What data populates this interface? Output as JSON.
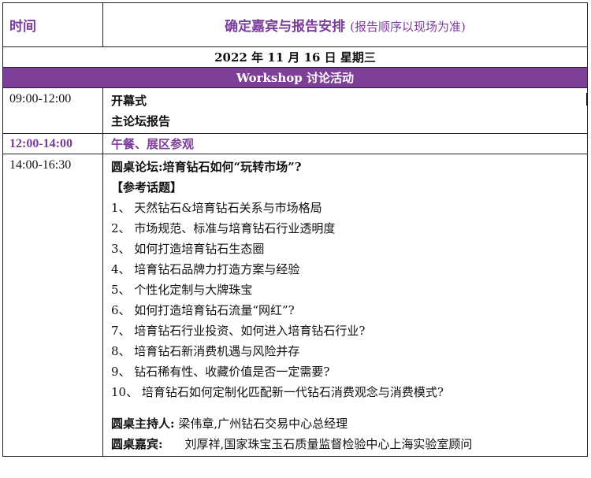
{
  "header": {
    "time_label": "时间",
    "title": "确定嘉宾与报告安排",
    "title_note": "(报告顺序以现场为准)"
  },
  "date_line": "2022 年 11 月 16 日    星期三",
  "workshop_bar": "Workshop 讨论活动",
  "sessions": [
    {
      "time": "09:00-12:00",
      "lines": [
        "开幕式",
        "主论坛报告"
      ]
    },
    {
      "time": "12:00-14:00",
      "text": "午餐、展区参观"
    },
    {
      "time": "14:00-16:30",
      "title": "圆桌论坛:培育钻石如何“玩转市场”?",
      "topics_header": "【参考话题】",
      "topics": [
        "1、 天然钻石&培育钻石关系与市场格局",
        "2、 市场规范、标准与培育钻石行业透明度",
        "3、 如何打造培育钻石生态圈",
        "4、 培育钻石品牌力打造方案与经验",
        "5、 个性化定制与大牌珠宝",
        "6、 如何打造培育钻石流量“网红”?",
        "7、 培育钻石行业投资、如何进入培育钻石行业?",
        "8、 培育钻石新消费机遇与风险并存",
        "9、 钻石稀有性、收藏价值是否一定需要?",
        "10、 培育钻石如何定制化匹配新一代钻石消费观念与消费模式?"
      ],
      "host_label": "圆桌主持人:",
      "host": "梁伟章,广州钻石交易中心总经理",
      "guest_label": "圆桌嘉宾:",
      "guest": "刘厚祥,国家珠宝玉石质量监督检验中心上海实验室顾问"
    }
  ]
}
